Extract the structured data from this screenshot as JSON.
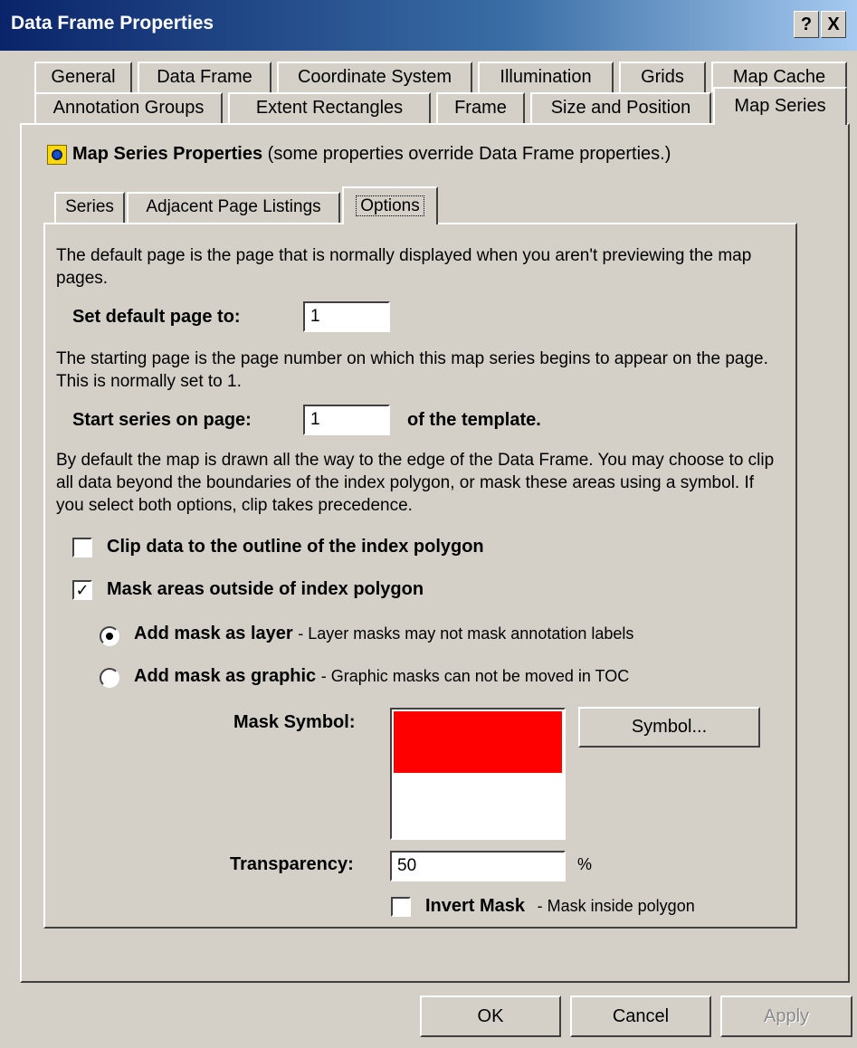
{
  "window": {
    "title": "Data Frame Properties",
    "help_label": "?",
    "close_label": "X"
  },
  "tabs_row_back": [
    "General",
    "Data Frame",
    "Coordinate System",
    "Illumination",
    "Grids",
    "Map Cache"
  ],
  "tabs_row_front": [
    "Annotation Groups",
    "Extent Rectangles",
    "Frame",
    "Size and Position",
    "Map Series"
  ],
  "header": {
    "title": "Map Series Properties",
    "note": "(some properties override Data Frame properties.)"
  },
  "subtabs": [
    "Series",
    "Adjacent Page Listings",
    "Options"
  ],
  "options": {
    "default_page_desc": "The default page is the page that is normally displayed when you aren't previewing the map pages.",
    "default_page_label": "Set default page to:",
    "default_page_value": "1",
    "start_page_desc": "The starting page is the page number on which this map series begins to appear on the page.  This is normally set to 1.",
    "start_page_label": "Start series on page:",
    "start_page_value": "1",
    "start_page_suffix": "of the template.",
    "clip_desc": "By default the map is drawn all the way to the edge of the Data Frame. You may choose to clip all data beyond the boundaries of the index polygon, or mask these areas using a symbol.  If you select both options, clip takes precedence.",
    "clip_label": "Clip data to the outline of the index polygon",
    "clip_checked": false,
    "mask_label": "Mask areas outside of index polygon",
    "mask_checked": true,
    "radio_layer_label": "Add mask as layer",
    "radio_layer_desc": "- Layer masks may not mask annotation labels",
    "radio_graphic_label": "Add mask as graphic",
    "radio_graphic_desc": "- Graphic masks can not be moved in TOC",
    "selected_radio": "layer",
    "mask_symbol_label": "Mask Symbol:",
    "mask_symbol_color": "#ff0000",
    "symbol_button": "Symbol...",
    "transparency_label": "Transparency:",
    "transparency_value": "50",
    "transparency_unit": "%",
    "invert_label": "Invert Mask",
    "invert_desc": "- Mask inside polygon",
    "invert_checked": false
  },
  "buttons": {
    "ok": "OK",
    "cancel": "Cancel",
    "apply": "Apply"
  }
}
